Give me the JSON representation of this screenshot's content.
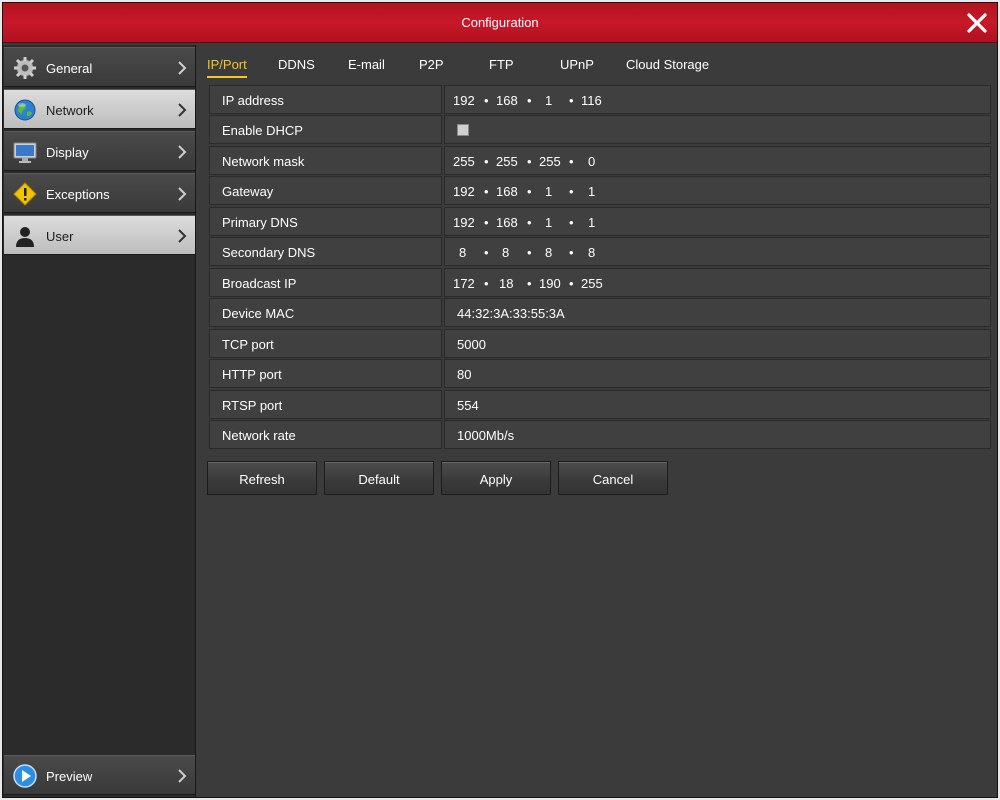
{
  "window": {
    "title": "Configuration"
  },
  "sidebar": {
    "items": [
      {
        "label": "General"
      },
      {
        "label": "Network"
      },
      {
        "label": "Display"
      },
      {
        "label": "Exceptions"
      },
      {
        "label": "User"
      }
    ],
    "preview": {
      "label": "Preview"
    }
  },
  "tabs": [
    "IP/Port",
    "DDNS",
    "E-mail",
    "P2P",
    "FTP",
    "UPnP",
    "Cloud Storage"
  ],
  "form": {
    "ip_address": {
      "label": "IP address",
      "octets": [
        "192",
        "168",
        "1",
        "116"
      ]
    },
    "dhcp": {
      "label": "Enable DHCP",
      "checked": false
    },
    "network_mask": {
      "label": "Network mask",
      "octets": [
        "255",
        "255",
        "255",
        "0"
      ]
    },
    "gateway": {
      "label": "Gateway",
      "octets": [
        "192",
        "168",
        "1",
        "1"
      ]
    },
    "primary_dns": {
      "label": "Primary DNS",
      "octets": [
        "192",
        "168",
        "1",
        "1"
      ]
    },
    "secondary_dns": {
      "label": "Secondary DNS",
      "octets": [
        "8",
        "8",
        "8",
        "8"
      ]
    },
    "broadcast_ip": {
      "label": "Broadcast IP",
      "octets": [
        "172",
        "18",
        "190",
        "255"
      ]
    },
    "device_mac": {
      "label": "Device MAC",
      "value": "44:32:3A:33:55:3A"
    },
    "tcp_port": {
      "label": "TCP port",
      "value": "5000"
    },
    "http_port": {
      "label": "HTTP port",
      "value": "80"
    },
    "rtsp_port": {
      "label": "RTSP port",
      "value": "554"
    },
    "network_rate": {
      "label": "Network rate",
      "value": "1000Mb/s"
    }
  },
  "buttons": {
    "refresh": "Refresh",
    "default": "Default",
    "apply": "Apply",
    "cancel": "Cancel"
  },
  "colors": {
    "title_bar": "#c8182a",
    "active_tab": "#f2c62a",
    "background": "#3b3b3b"
  }
}
